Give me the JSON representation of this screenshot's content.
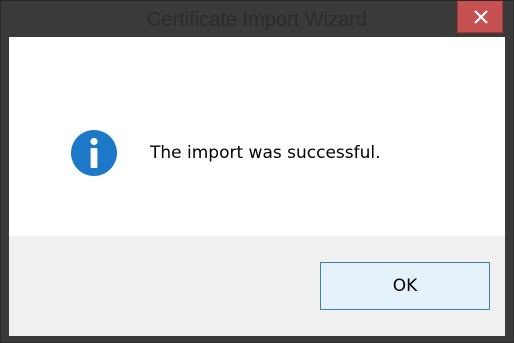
{
  "window": {
    "title": "Certificate Import Wizard",
    "close_icon": "close-icon"
  },
  "message": {
    "icon": "info-icon",
    "text": "The import was successful."
  },
  "footer": {
    "ok_label": "OK"
  },
  "colors": {
    "frame": "#3a3a3a",
    "close_button": "#c75050",
    "info_icon": "#1e78c8",
    "footer_bg": "#f0f0f0",
    "button_border": "#3c7fb1",
    "button_bg": "#e5f1fb"
  }
}
